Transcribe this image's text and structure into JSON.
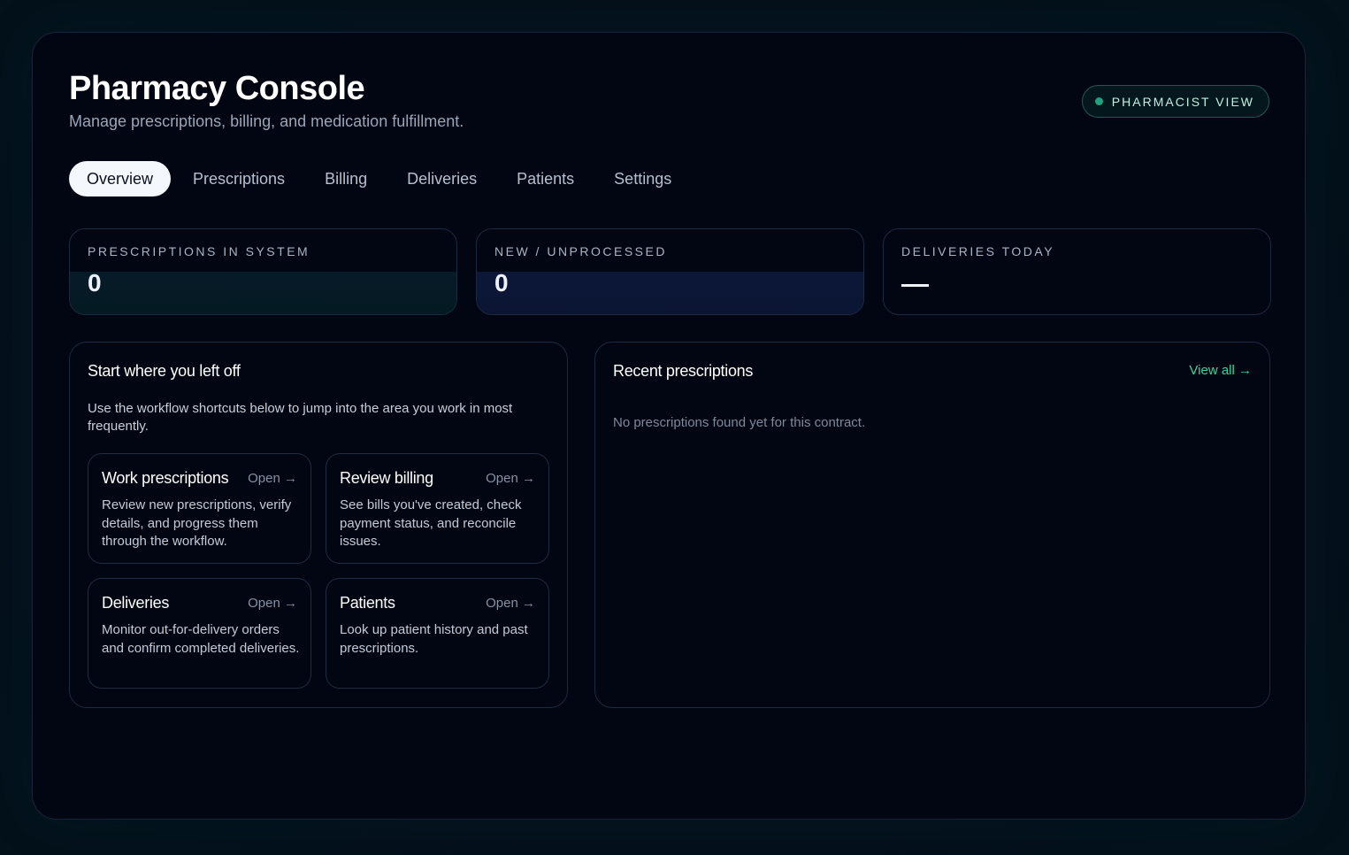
{
  "header": {
    "title": "Pharmacy Console",
    "subtitle": "Manage prescriptions, billing, and medication fulfillment.",
    "role_badge": "PHARMACIST VIEW"
  },
  "tabs": [
    {
      "label": "Overview",
      "active": true
    },
    {
      "label": "Prescriptions",
      "active": false
    },
    {
      "label": "Billing",
      "active": false
    },
    {
      "label": "Deliveries",
      "active": false
    },
    {
      "label": "Patients",
      "active": false
    },
    {
      "label": "Settings",
      "active": false
    }
  ],
  "stats": [
    {
      "label": "PRESCRIPTIONS IN SYSTEM",
      "value": "0"
    },
    {
      "label": "NEW / UNPROCESSED",
      "value": "0"
    },
    {
      "label": "DELIVERIES TODAY",
      "value": "—"
    }
  ],
  "shortcuts_panel": {
    "title": "Start where you left off",
    "description": "Use the workflow shortcuts below to jump into the area you work in most frequently.",
    "items": [
      {
        "title": "Work prescriptions",
        "open_label": "Open →",
        "description": "Review new prescriptions, verify details, and progress them through the workflow."
      },
      {
        "title": "Review billing",
        "open_label": "Open →",
        "description": "See bills you've created, check payment status, and reconcile issues."
      },
      {
        "title": "Deliveries",
        "open_label": "Open →",
        "description": "Monitor out-for-delivery orders and confirm completed deliveries."
      },
      {
        "title": "Patients",
        "open_label": "Open →",
        "description": "Look up patient history and past prescriptions."
      }
    ]
  },
  "recent_panel": {
    "title": "Recent prescriptions",
    "view_all": "View all →",
    "empty_message": "No prescriptions found yet for this contract."
  },
  "colors": {
    "accent": "#35d6a0",
    "badge_dot": "#1ea37f",
    "background": "#020512"
  }
}
